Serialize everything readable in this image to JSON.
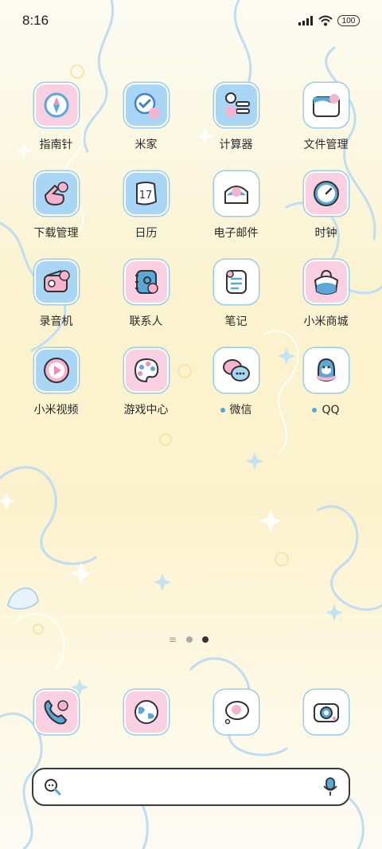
{
  "status_bar": {
    "time": "8:16",
    "battery": "100"
  },
  "apps": [
    {
      "label": "指南针",
      "icon": "compass-icon",
      "bg": "pink"
    },
    {
      "label": "米家",
      "icon": "mijia-icon",
      "bg": "blue"
    },
    {
      "label": "计算器",
      "icon": "calculator-icon",
      "bg": "blue"
    },
    {
      "label": "文件管理",
      "icon": "folder-icon",
      "bg": "white"
    },
    {
      "label": "下载管理",
      "icon": "download-icon",
      "bg": "blue"
    },
    {
      "label": "日历",
      "icon": "calendar-icon",
      "bg": "blue",
      "text": "17"
    },
    {
      "label": "电子邮件",
      "icon": "mail-icon",
      "bg": "white"
    },
    {
      "label": "时钟",
      "icon": "clock-icon",
      "bg": "pink"
    },
    {
      "label": "录音机",
      "icon": "recorder-icon",
      "bg": "blue"
    },
    {
      "label": "联系人",
      "icon": "contacts-icon",
      "bg": "pink"
    },
    {
      "label": "笔记",
      "icon": "notes-icon",
      "bg": "white"
    },
    {
      "label": "小米商城",
      "icon": "shopping-bag-icon",
      "bg": "pink"
    },
    {
      "label": "小米视频",
      "icon": "video-play-icon",
      "bg": "blue"
    },
    {
      "label": "游戏中心",
      "icon": "game-palette-icon",
      "bg": "pink"
    },
    {
      "label": "微信",
      "icon": "wechat-icon",
      "bg": "white",
      "new": true
    },
    {
      "label": "QQ",
      "icon": "qq-penguin-icon",
      "bg": "white",
      "new": true
    }
  ],
  "dock": [
    {
      "icon": "phone-icon",
      "bg": "pink"
    },
    {
      "icon": "browser-globe-icon",
      "bg": "pink"
    },
    {
      "icon": "messages-icon",
      "bg": "white"
    },
    {
      "icon": "camera-icon",
      "bg": "white"
    }
  ],
  "page_indicator": {
    "pages": 2,
    "active": 2
  },
  "search": {
    "placeholder": ""
  },
  "colors": {
    "pink": "#f9cfe2",
    "blue": "#a9d6f5",
    "accent": "#54a6e0",
    "line": "#9ccbe8"
  }
}
